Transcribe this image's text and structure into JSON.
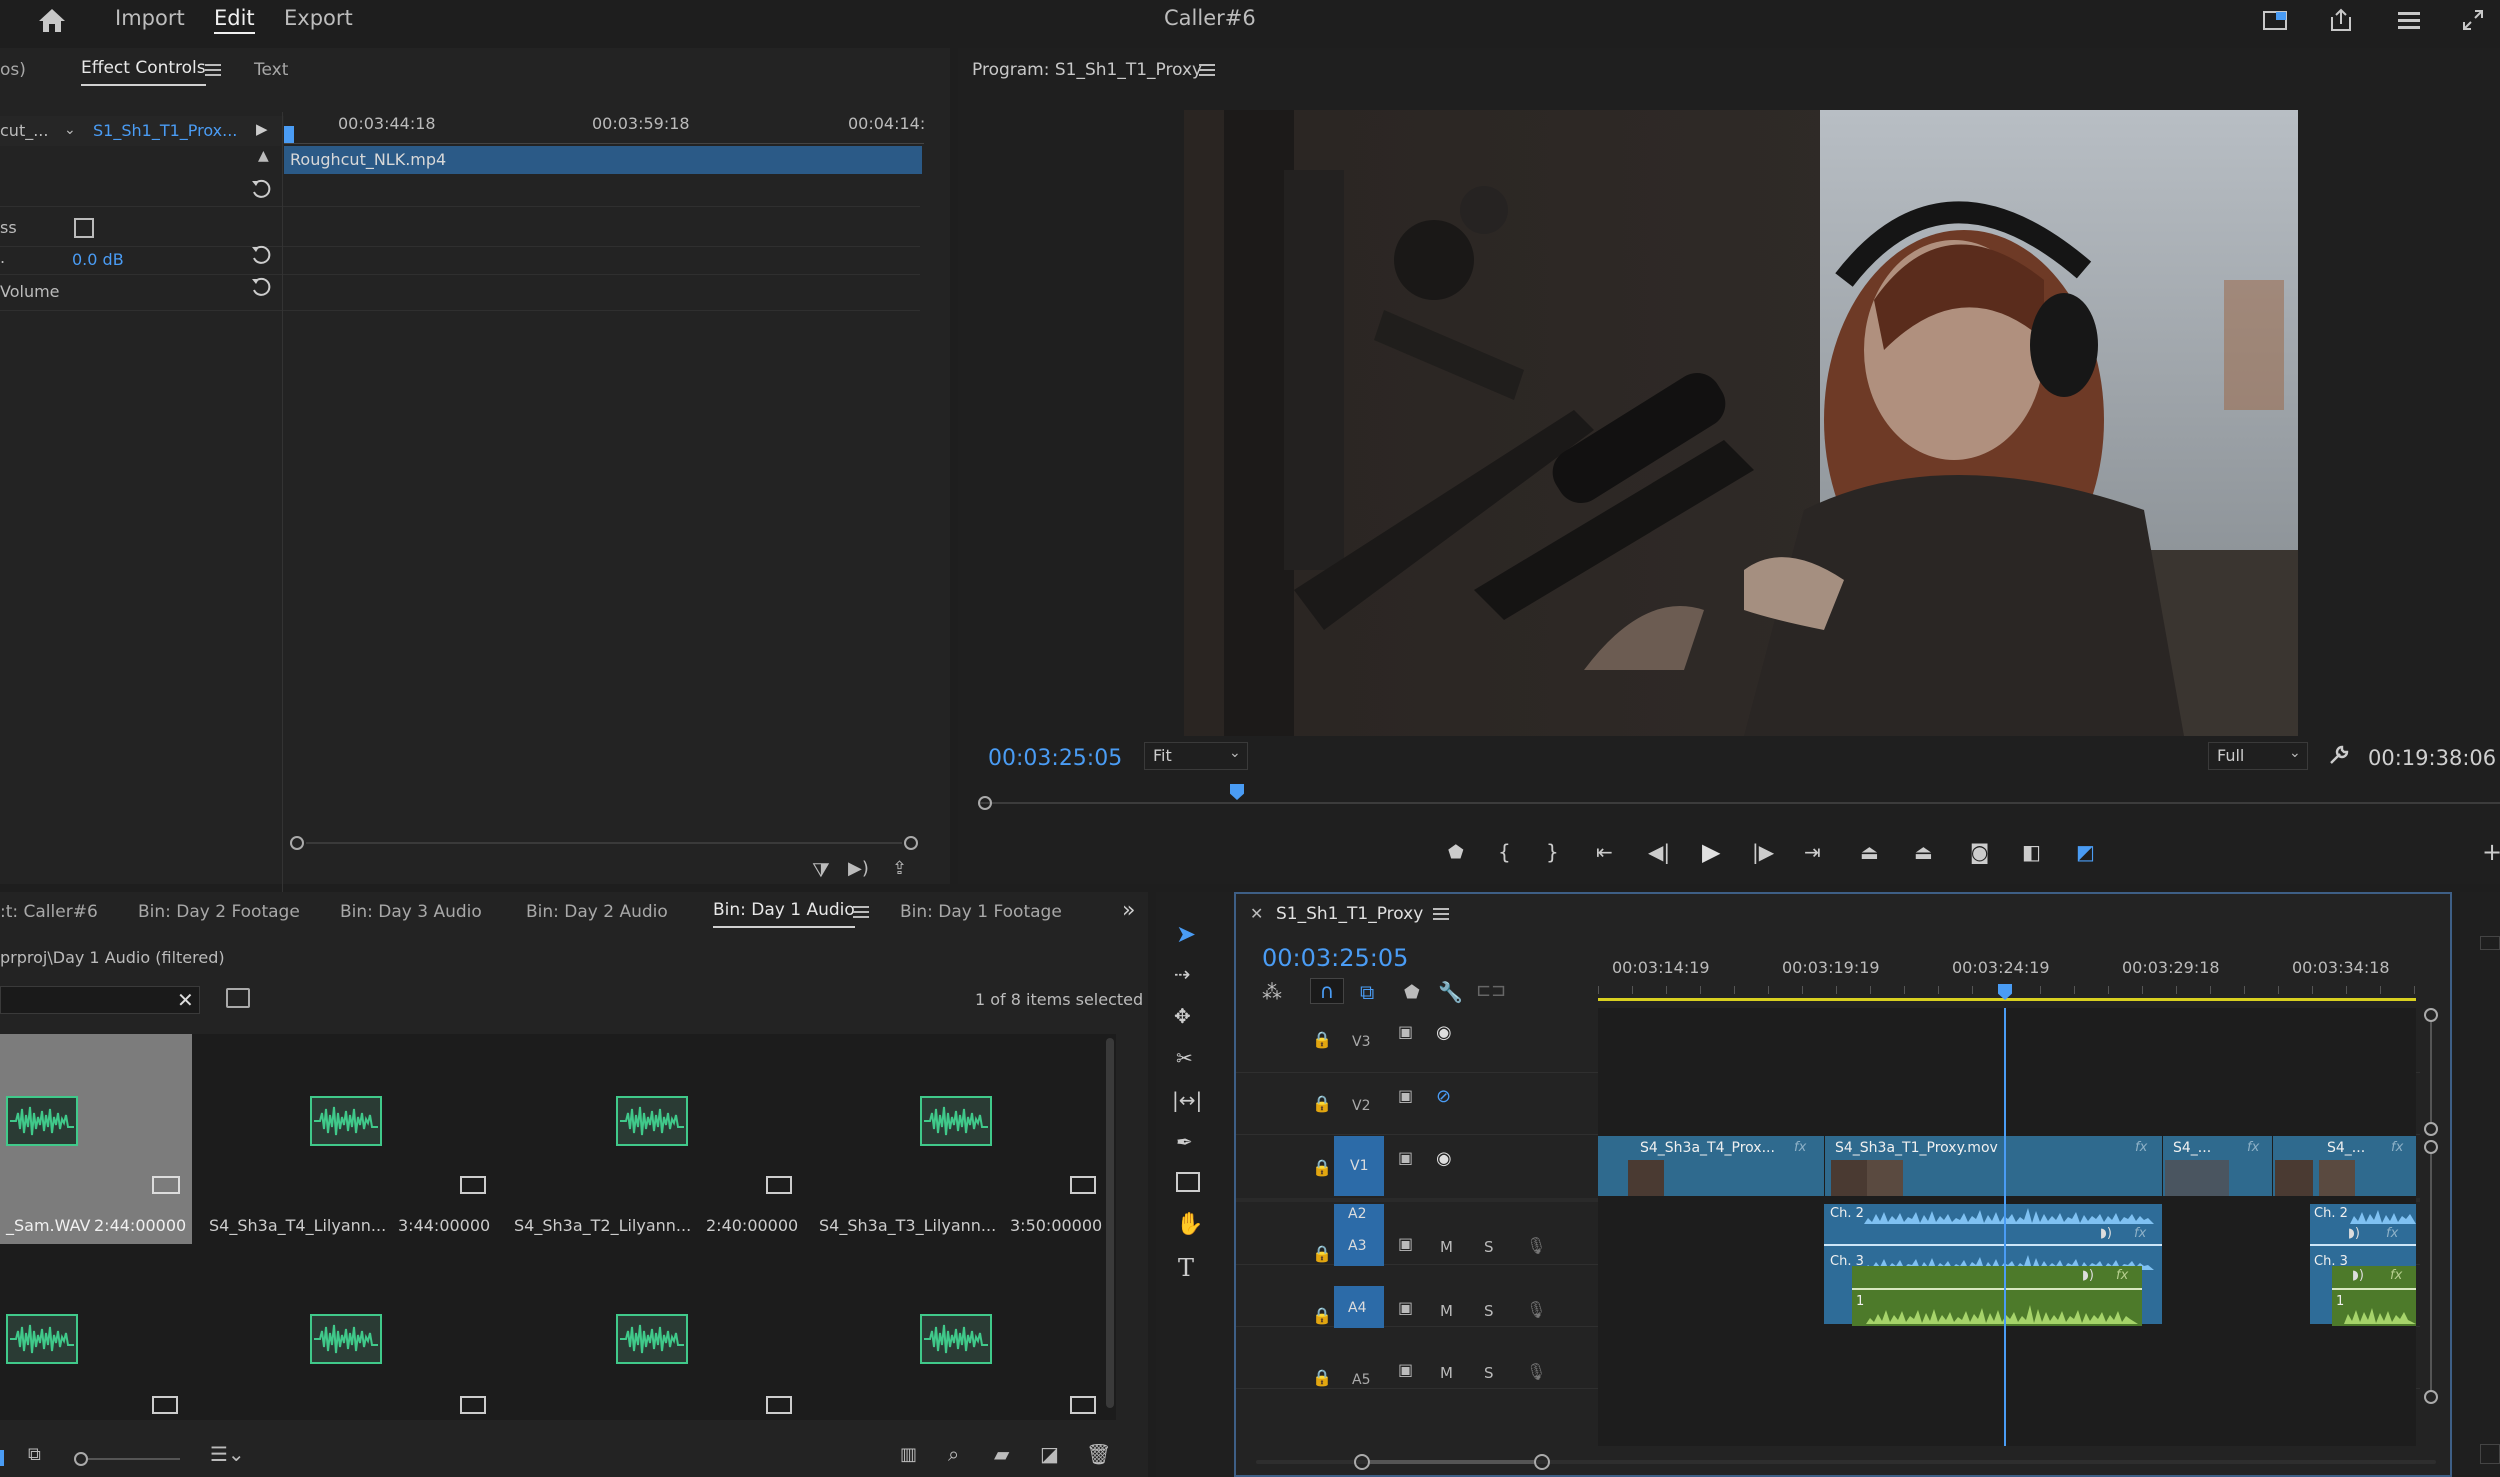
{
  "menubar": {
    "home_icon": "home-icon",
    "items": [
      "Import",
      "Edit",
      "Export"
    ],
    "active": "Edit",
    "title": "Caller#6",
    "right_icons": [
      "workspaces-icon",
      "share-icon",
      "panel-menu-icon",
      "fullscreen-icon"
    ]
  },
  "effect_controls": {
    "tabs": [
      "os)",
      "Effect Controls",
      "Text"
    ],
    "active_tab": "Effect Controls",
    "source_label": "cut_...",
    "sequence_label": "S1_Sh1_T1_Prox...",
    "timecodes": [
      "00:03:44:18",
      "00:03:59:18",
      "00:04:14:"
    ],
    "clip_name": "Roughcut_NLK.mp4",
    "rows": [
      {
        "label": "ss",
        "value": ""
      },
      {
        "label": ".",
        "value": "0.0 dB"
      },
      {
        "label": " Volume",
        "value": ""
      }
    ]
  },
  "program_monitor": {
    "title": "Program: S1_Sh1_T1_Proxy",
    "current_timecode": "00:03:25:05",
    "zoom": "Fit",
    "resolution": "Full",
    "duration": "00:19:38:06"
  },
  "project_panel": {
    "tabs": [
      ":t: Caller#6",
      "Bin: Day 2 Footage",
      "Bin: Day 3 Audio",
      "Bin: Day 2 Audio",
      "Bin: Day 1 Audio",
      "Bin: Day 1 Footage"
    ],
    "active_tab": "Bin: Day 1 Audio",
    "path": "prproj\\Day 1 Audio (filtered)",
    "selection_status": "1 of 8 items selected",
    "items": [
      {
        "name": "_Sam.WAV",
        "duration": "2:44:00000",
        "selected": true
      },
      {
        "name": "S4_Sh3a_T4_Lilyann...",
        "duration": "3:44:00000",
        "selected": false
      },
      {
        "name": "S4_Sh3a_T2_Lilyann...",
        "duration": "2:40:00000",
        "selected": false
      },
      {
        "name": "S4_Sh3a_T3_Lilyann...",
        "duration": "3:50:00000",
        "selected": false
      },
      {
        "name": "",
        "duration": "",
        "selected": false
      },
      {
        "name": "",
        "duration": "",
        "selected": false
      },
      {
        "name": "",
        "duration": "",
        "selected": false
      },
      {
        "name": "",
        "duration": "",
        "selected": false
      }
    ]
  },
  "timeline": {
    "sequence_name": "S1_Sh1_T1_Proxy",
    "current_timecode": "00:03:25:05",
    "ruler": [
      "00:03:14:19",
      "00:03:19:19",
      "00:03:24:19",
      "00:03:29:18",
      "00:03:34:18"
    ],
    "tracks": [
      {
        "id": "V3",
        "type": "video"
      },
      {
        "id": "V2",
        "type": "video"
      },
      {
        "id": "V1",
        "type": "video"
      },
      {
        "id": "A2",
        "type": "audio"
      },
      {
        "id": "A3",
        "type": "audio"
      },
      {
        "id": "A4",
        "type": "audio"
      },
      {
        "id": "A5",
        "type": "audio"
      }
    ],
    "clips": [
      {
        "name": "S4_Sh3a_T4_Prox...",
        "track": "V1"
      },
      {
        "name": "S4_Sh3a_T1_Proxy.mov",
        "track": "V1"
      },
      {
        "name": "S4_...",
        "track": "V1"
      },
      {
        "name": "S4_...",
        "track": "V1"
      }
    ],
    "audio_labels": [
      "Ch. 2",
      "Ch. 3",
      "1",
      "Ch. 2",
      "Ch. 3",
      "1"
    ],
    "track_buttons": {
      "mute": "M",
      "solo": "S"
    },
    "fx": "fx"
  },
  "colors": {
    "accent": "#4a9cf4",
    "video_clip": "#2f6a8e",
    "audio_clip_blue": "#2e6c98",
    "audio_clip_green": "#4d7a2a",
    "waveform_green": "#40c98a"
  }
}
